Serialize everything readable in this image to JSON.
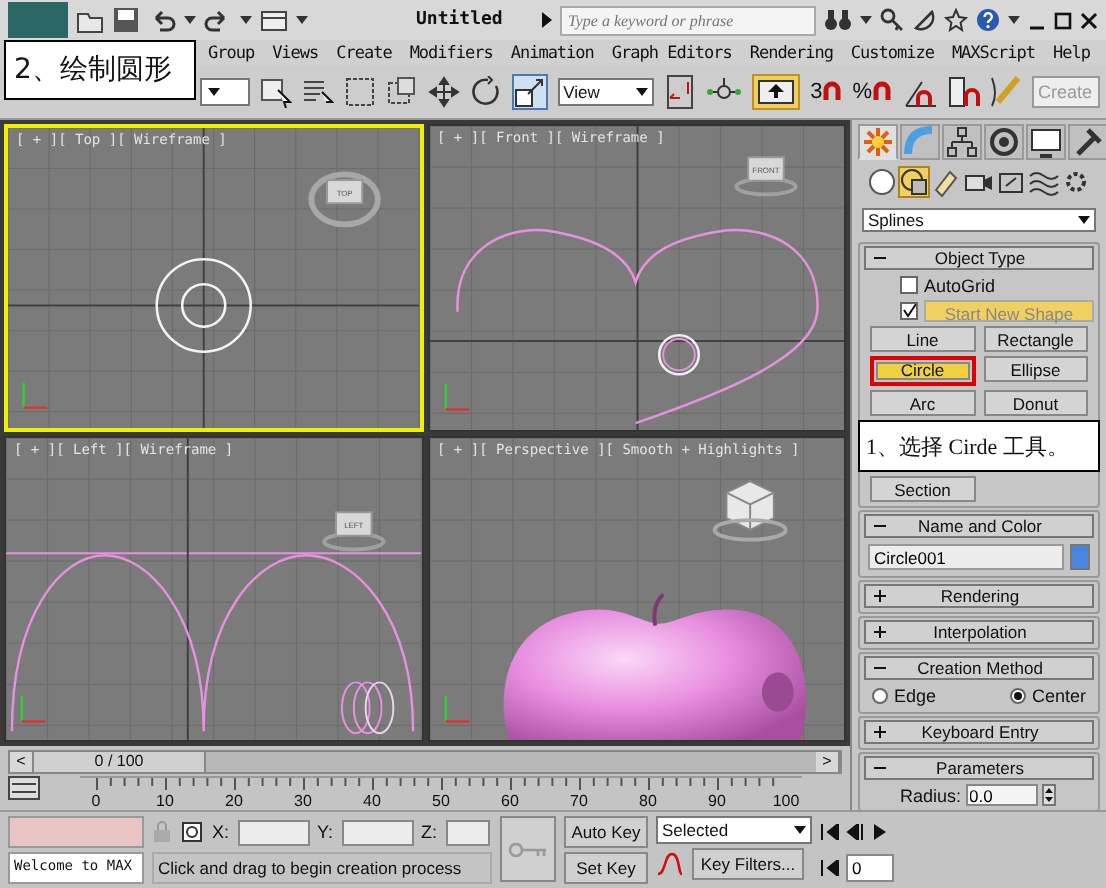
{
  "title_bar": {
    "title": "Untitled",
    "search": {
      "placeholder": "Type a keyword or phrase"
    }
  },
  "annotation": "2、绘制圆形",
  "menu": [
    {
      "label": "Group"
    },
    {
      "label": "Views"
    },
    {
      "label": "Create"
    },
    {
      "label": "Modifiers"
    },
    {
      "label": "Animation"
    },
    {
      "label": "Graph Editors"
    },
    {
      "label": "Rendering"
    },
    {
      "label": "Customize"
    },
    {
      "label": "MAXScript"
    },
    {
      "label": "Help"
    }
  ],
  "toolbar": {
    "view_dropdown": "View",
    "snaps": [
      "3",
      "%"
    ],
    "keyboard_toggle_on": true,
    "create_field": {
      "placeholder": "Create"
    }
  },
  "viewports": [
    {
      "kind": "top",
      "label": "[ + ][ Top ][ Wireframe ]",
      "cube": "TOP",
      "active": true
    },
    {
      "kind": "front",
      "label": "[ + ][ Front ][ Wireframe ]",
      "cube": "FRONT",
      "active": false
    },
    {
      "kind": "left",
      "label": "[ + ][ Left ][ Wireframe ]",
      "cube": "LEFT",
      "active": false
    },
    {
      "kind": "perspective",
      "label": "[ + ][ Perspective ][ Smooth + Highlights ]",
      "active": false
    }
  ],
  "command_panel": {
    "tabs": [
      {
        "kind": "create",
        "selected": true
      },
      {
        "kind": "modify",
        "selected": false
      },
      {
        "kind": "hierarchy",
        "selected": false
      },
      {
        "kind": "motion",
        "selected": false
      },
      {
        "kind": "display",
        "selected": false
      },
      {
        "kind": "utilities",
        "selected": false
      }
    ],
    "categories": [
      {
        "kind": "geometry",
        "selected": false
      },
      {
        "kind": "shapes",
        "selected": true
      },
      {
        "kind": "lights",
        "selected": false
      },
      {
        "kind": "cameras",
        "selected": false
      },
      {
        "kind": "helpers",
        "selected": false
      },
      {
        "kind": "spacewarps",
        "selected": false
      },
      {
        "kind": "systems",
        "selected": false
      }
    ],
    "dropdown": "Splines",
    "rollouts": [
      {
        "kind": "object_type",
        "title": "Object Type",
        "expanded": true,
        "autogrid": {
          "label": "AutoGrid",
          "checked": false
        },
        "start_new_shape": {
          "label": "Start New Shape",
          "checked": true
        },
        "buttons": [
          {
            "kind": "button",
            "label": "Line",
            "selected": false,
            "highlighted": false
          },
          {
            "kind": "button",
            "label": "Rectangle",
            "selected": false,
            "highlighted": false
          },
          {
            "kind": "button",
            "label": "Circle",
            "selected": true,
            "highlighted": true
          },
          {
            "kind": "button",
            "label": "Ellipse",
            "selected": false,
            "highlighted": false
          },
          {
            "kind": "button",
            "label": "Arc",
            "selected": false,
            "highlighted": false
          },
          {
            "kind": "button",
            "label": "Donut",
            "selected": false,
            "highlighted": false
          },
          {
            "kind": "note",
            "label": "1、选择 Cirde 工具。"
          },
          {
            "kind": "button",
            "label": "Section",
            "selected": false,
            "highlighted": false
          }
        ]
      },
      {
        "kind": "name_color",
        "title": "Name and Color",
        "expanded": true,
        "name": "Circle001",
        "color": "#4a86e0"
      },
      {
        "kind": "plain",
        "title": "Rendering",
        "expanded": false
      },
      {
        "kind": "plain",
        "title": "Interpolation",
        "expanded": false
      },
      {
        "kind": "creation_method",
        "title": "Creation Method",
        "expanded": true,
        "options": [
          {
            "label": "Edge",
            "selected": false
          },
          {
            "label": "Center",
            "selected": true
          }
        ]
      },
      {
        "kind": "plain",
        "title": "Keyboard Entry",
        "expanded": false
      },
      {
        "kind": "parameters",
        "title": "Parameters",
        "expanded": true,
        "fields": [
          {
            "label": "Radius:",
            "value": "0.0"
          }
        ]
      }
    ]
  },
  "time_slider": {
    "prev": "<",
    "position": "0 / 100",
    "next": ">",
    "level": 0
  },
  "ruler": [
    "0",
    "10",
    "20",
    "30",
    "40",
    "50",
    "60",
    "70",
    "80",
    "90",
    "100"
  ],
  "status": {
    "welcome": "Welcome to MAX",
    "x_label": "X:",
    "y_label": "Y:",
    "z_label": "Z:",
    "prompt": "Click and drag to begin creation process",
    "auto_key": "Auto Key",
    "set_key": "Set Key",
    "key_mode": "Selected",
    "key_filters": "Key Filters...",
    "frame": "0"
  }
}
